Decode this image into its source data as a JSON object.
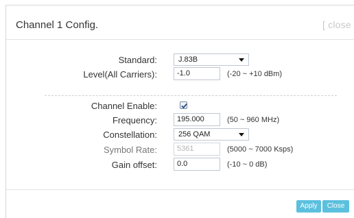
{
  "dialog": {
    "title": "Channel 1 Config.",
    "close_label": "[ close ]"
  },
  "form": {
    "standard": {
      "label": "Standard:",
      "value": "J.83B"
    },
    "level": {
      "label": "Level(All Carriers):",
      "value": "-1.0",
      "hint": "(-20 ~ +10 dBm)"
    },
    "channel_enable": {
      "label": "Channel Enable:",
      "checked": true
    },
    "frequency": {
      "label": "Frequency:",
      "value": "195.000",
      "hint": "(50 ~ 960 MHz)"
    },
    "constellation": {
      "label": "Constellation:",
      "value": "256 QAM"
    },
    "symbol_rate": {
      "label": "Symbol Rate:",
      "value": "5361",
      "hint": "(5000 ~ 7000 Ksps)"
    },
    "gain_offset": {
      "label": "Gain offset:",
      "value": "0.0",
      "hint": "(-10 ~ 0 dB)"
    }
  },
  "footer": {
    "apply_label": "Apply",
    "close_label": "Close"
  },
  "colors": {
    "accent": "#5bc0de",
    "muted_text": "#c9c9c9"
  }
}
